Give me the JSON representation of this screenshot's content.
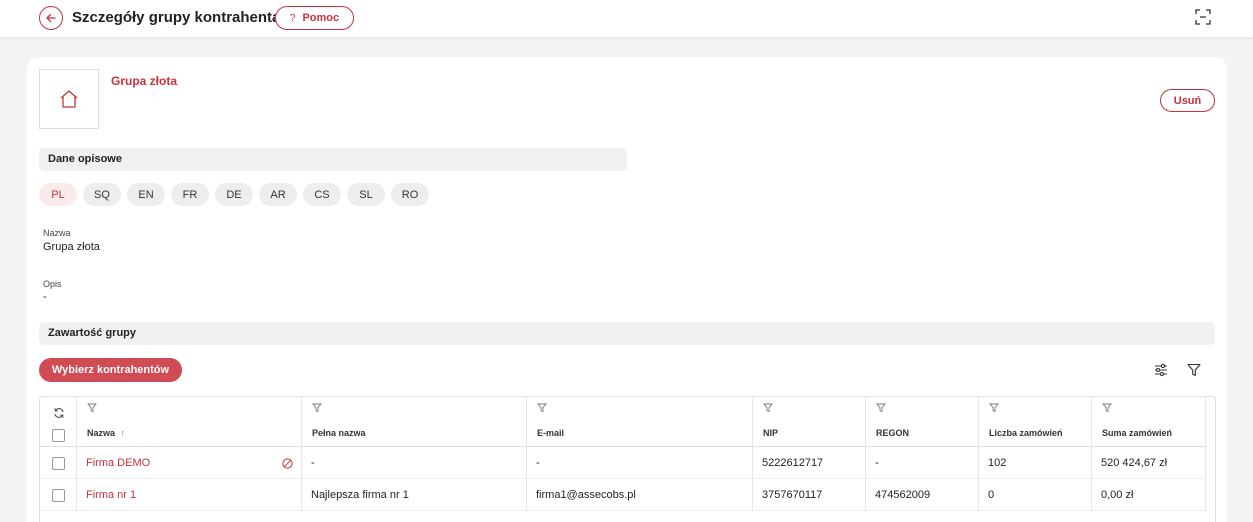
{
  "header": {
    "title": "Szczegóły grupy kontrahenta",
    "help_label": "Pomoc",
    "help_icon": "?"
  },
  "group": {
    "name": "Grupa złota",
    "delete_label": "Usuń"
  },
  "sections": {
    "descriptive": "Dane opisowe",
    "contents": "Zawartość grupy"
  },
  "languages": [
    "PL",
    "SQ",
    "EN",
    "FR",
    "DE",
    "AR",
    "CS",
    "SL",
    "RO"
  ],
  "active_language": "PL",
  "fields": {
    "name_label": "Nazwa",
    "name_value": "Grupa złota",
    "desc_label": "Opis",
    "desc_value": "-"
  },
  "actions": {
    "select_contractors": "Wybierz kontrahentów"
  },
  "table": {
    "columns": [
      "Nazwa",
      "Pełna nazwa",
      "E-mail",
      "NIP",
      "REGON",
      "Liczba zamówień",
      "Suma zamówień"
    ],
    "sort_indicator": "↑",
    "rows": [
      [
        "Firma DEMO",
        "-",
        "-",
        "5222612717",
        "-",
        "102",
        "520 424,67 zł"
      ],
      [
        "Firma nr 1",
        "Najlepsza firma nr 1",
        "firma1@assecobs.pl",
        "3757670117",
        "474562009",
        "0",
        "0,00 zł"
      ]
    ]
  },
  "colors": {
    "accent": "#c8323c",
    "button_fill": "#d14b54",
    "section_bg": "#f0f0f2",
    "page_bg": "#f3f3f5"
  },
  "icons": [
    "back-arrow-icon",
    "fullscreen-icon",
    "home-icon",
    "settings-sliders-icon",
    "filter-icon",
    "refresh-icon",
    "blocked-icon"
  ]
}
